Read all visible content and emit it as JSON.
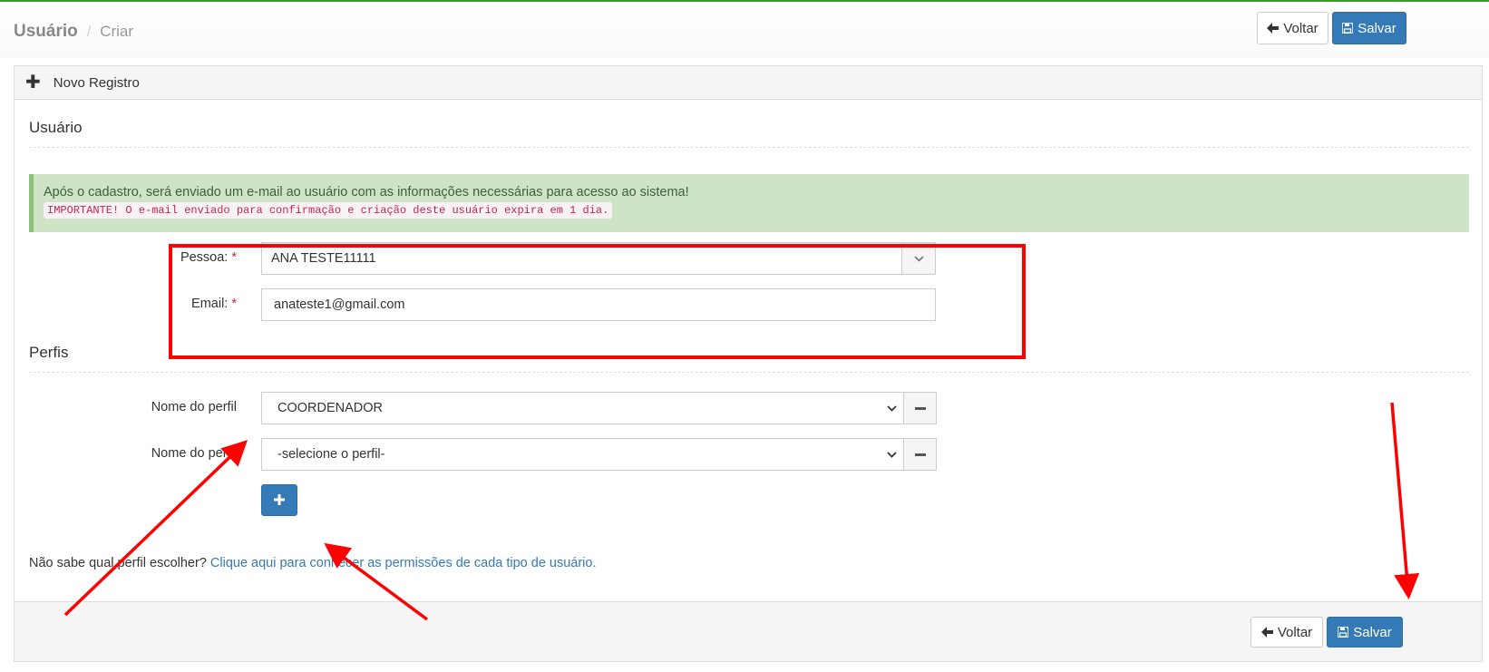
{
  "breadcrumb": {
    "title": "Usuário",
    "separator": "/",
    "current": "Criar"
  },
  "toolbar": {
    "back_label": "Voltar",
    "save_label": "Salvar"
  },
  "panel": {
    "heading": "Novo Registro"
  },
  "section_usuario": {
    "title": "Usuário"
  },
  "alert": {
    "message": "Após o cadastro, será enviado um e-mail ao usuário com as informações necessárias para acesso ao sistema!",
    "important": "IMPORTANTE! O e-mail enviado para confirmação e criação deste usuário expira em 1 dia."
  },
  "form": {
    "pessoa": {
      "label": "Pessoa:",
      "required": "*",
      "value": "ANA TESTE11111"
    },
    "email": {
      "label": "Email:",
      "required": "*",
      "value": "anateste1@gmail.com"
    }
  },
  "section_perfis": {
    "title": "Perfis"
  },
  "perfis": [
    {
      "label": "Nome do perfil",
      "value": "COORDENADOR"
    },
    {
      "label": "Nome do perfil",
      "value": "-selecione o perfil-"
    }
  ],
  "hint": {
    "text": "Não sabe qual perfil escolher?",
    "link": "Clique aqui para conhecer as permissões de cada tipo de usuário."
  },
  "footer": {
    "back_label": "Voltar",
    "save_label": "Salvar"
  },
  "colors": {
    "primary": "#337ab7",
    "alert_bg": "#cfe3c6",
    "annotation": "#ff0000",
    "top_accent": "#3c9a2e"
  },
  "icons": [
    "arrow-left-icon",
    "floppy-disk-icon",
    "plus-icon",
    "chevron-down-icon",
    "minus-icon"
  ]
}
